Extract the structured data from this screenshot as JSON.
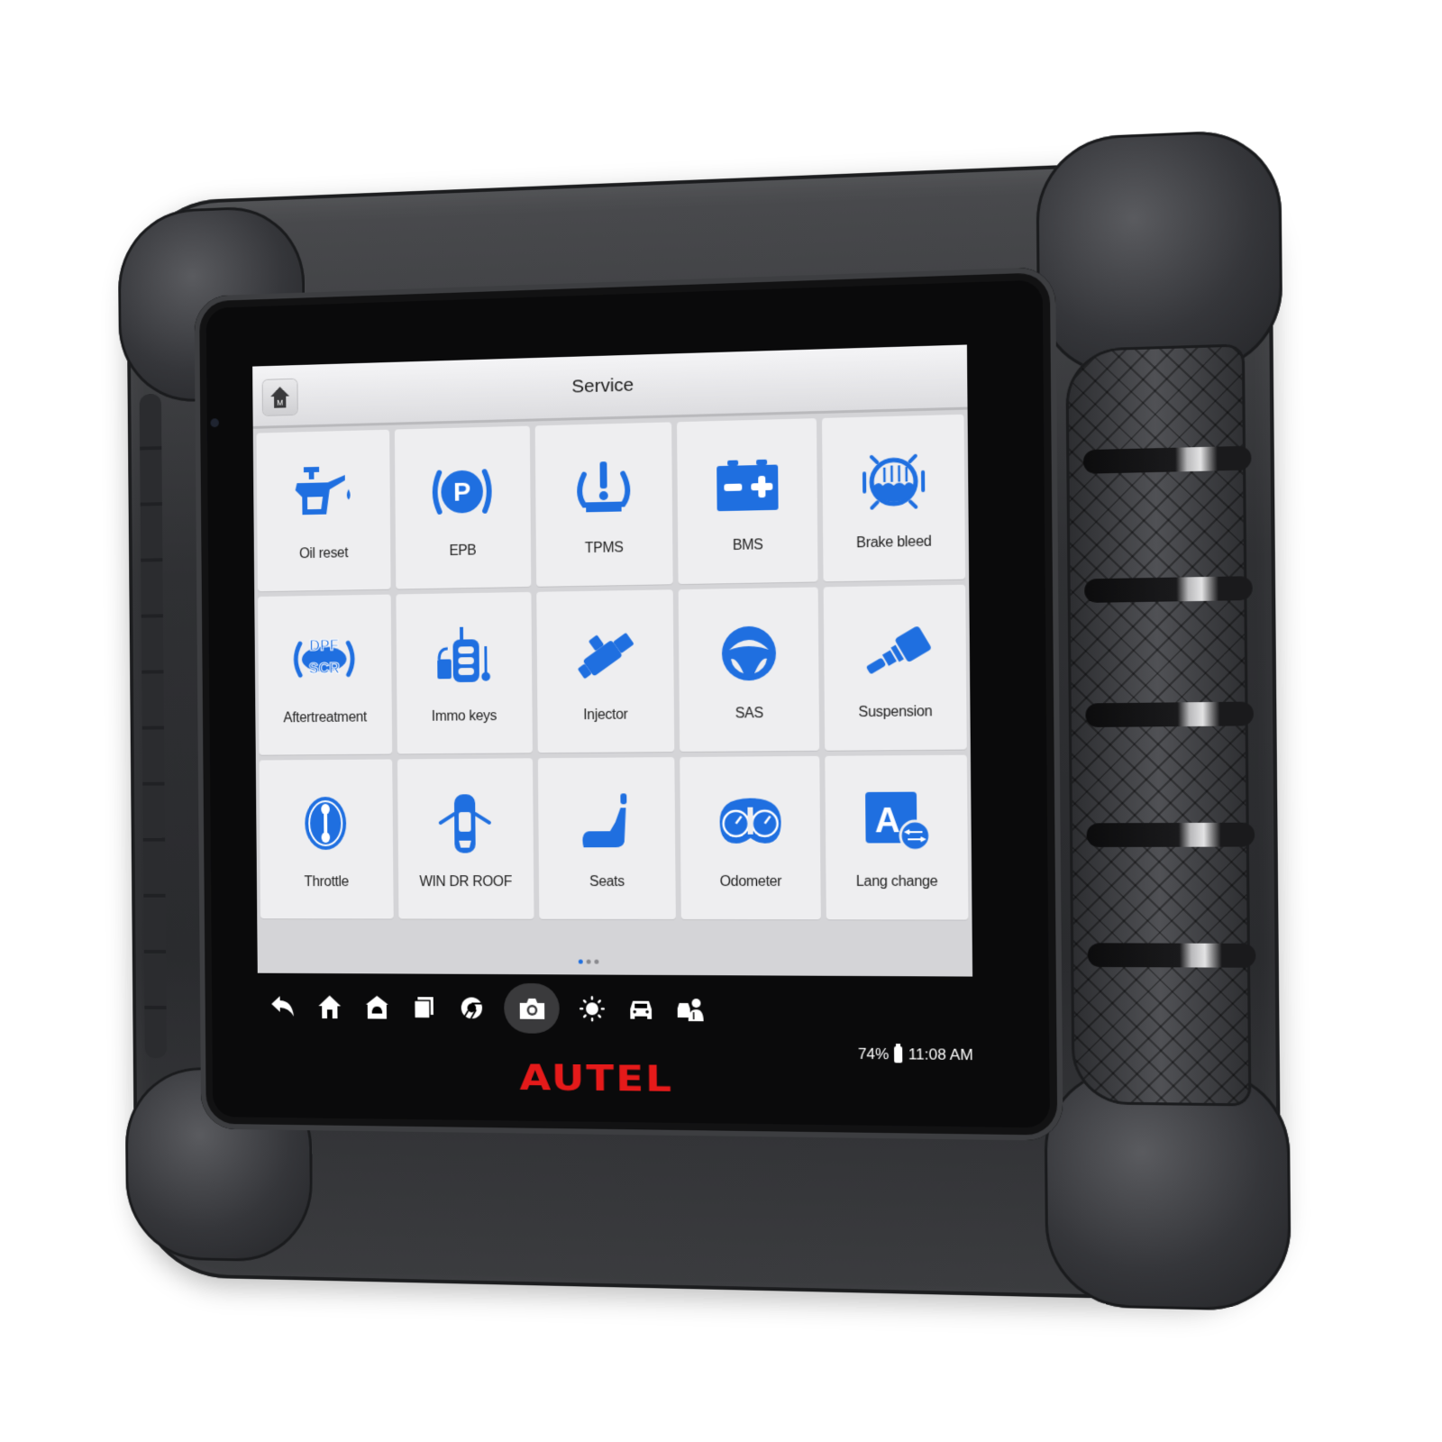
{
  "device": {
    "brand_logo": "AUTEL"
  },
  "header": {
    "title": "Service",
    "home_button_icon": "m-home-icon",
    "home_button_glyph": "M"
  },
  "accent_color": "#1f6fe0",
  "tiles": [
    {
      "label": "Oil reset",
      "icon": "oil-can-icon"
    },
    {
      "label": "EPB",
      "icon": "parking-brake-icon"
    },
    {
      "label": "TPMS",
      "icon": "tire-pressure-warning-icon"
    },
    {
      "label": "BMS",
      "icon": "battery-icon"
    },
    {
      "label": "Brake bleed",
      "icon": "brake-fluid-icon"
    },
    {
      "label": "Aftertreatment",
      "icon": "dpf-scr-icon",
      "icon_text_top": "DPF",
      "icon_text_bottom": "SCR"
    },
    {
      "label": "Immo keys",
      "icon": "immobilizer-key-icon"
    },
    {
      "label": "Injector",
      "icon": "injector-icon"
    },
    {
      "label": "SAS",
      "icon": "steering-wheel-icon"
    },
    {
      "label": "Suspension",
      "icon": "suspension-icon"
    },
    {
      "label": "Throttle",
      "icon": "throttle-icon"
    },
    {
      "label": "WIN DR ROOF",
      "icon": "car-doors-icon"
    },
    {
      "label": "Seats",
      "icon": "seat-icon"
    },
    {
      "label": "Odometer",
      "icon": "odometer-icon"
    },
    {
      "label": "Lang change",
      "icon": "language-change-icon",
      "icon_text": "A"
    }
  ],
  "pager": {
    "pages": 3,
    "current": 1
  },
  "navbar": [
    {
      "name": "back",
      "icon": "back-arrow-icon"
    },
    {
      "name": "home",
      "icon": "home-icon"
    },
    {
      "name": "android-home",
      "icon": "android-home-icon"
    },
    {
      "name": "recent-apps",
      "icon": "recent-apps-icon"
    },
    {
      "name": "browser",
      "icon": "chrome-icon"
    },
    {
      "name": "screenshot",
      "icon": "camera-icon",
      "active": true
    },
    {
      "name": "brightness",
      "icon": "brightness-icon"
    },
    {
      "name": "vci",
      "icon": "car-icon"
    },
    {
      "name": "remote-expert",
      "icon": "technician-icon"
    }
  ],
  "status_bar": {
    "battery": "74%",
    "time": "11:08 AM"
  }
}
